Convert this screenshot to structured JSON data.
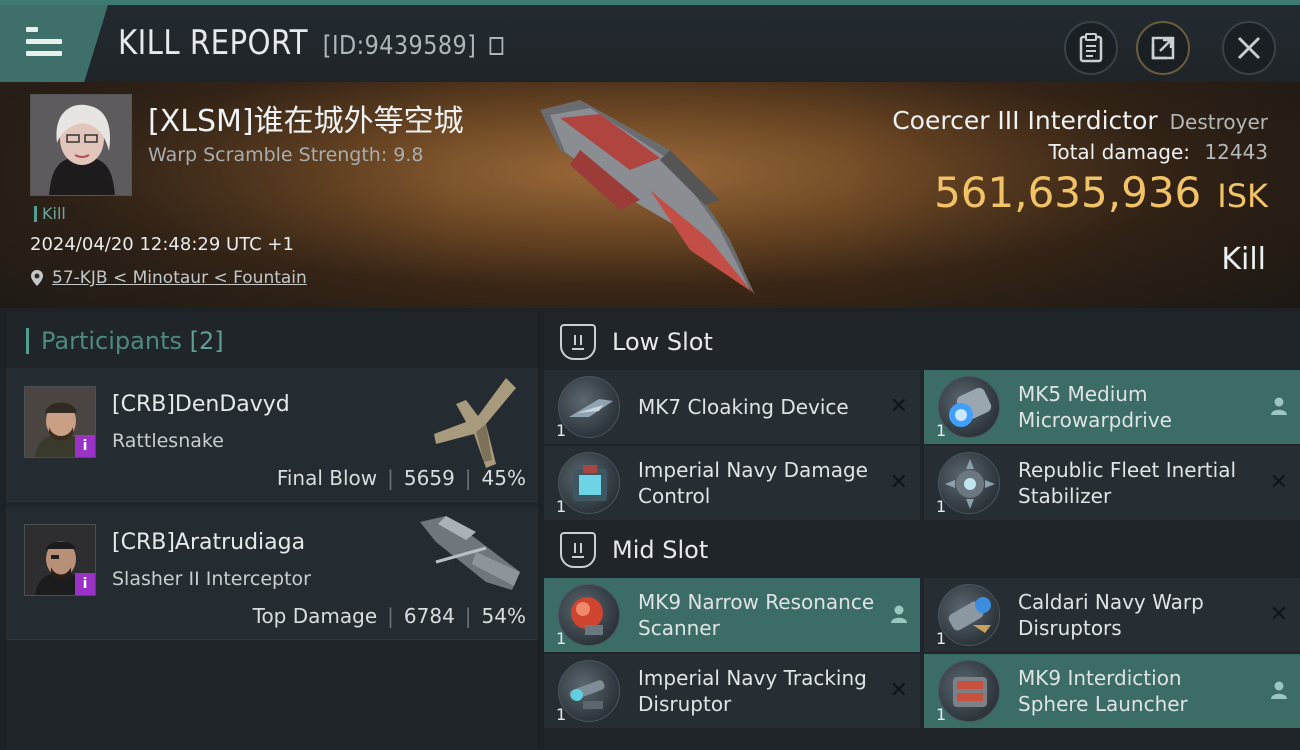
{
  "header": {
    "title": "KILL REPORT",
    "id_text": "[ID:9439589]"
  },
  "victim": {
    "pilot_name": "[XLSM]谁在城外等空城",
    "warp_scramble": "Warp Scramble Strength: 9.8",
    "tag": "Kill",
    "datetime": "2024/04/20 12:48:29 UTC +1",
    "location": "57-KJB < Minotaur < Fountain",
    "ship_name": "Coercer III Interdictor",
    "ship_class": "Destroyer",
    "total_damage_label": "Total damage:",
    "total_damage": "12443",
    "isk_value": "561,635,936",
    "isk_unit": "ISK",
    "result": "Kill"
  },
  "participants": {
    "label": "Participants",
    "count": "[2]",
    "items": [
      {
        "name": "[CRB]DenDavyd",
        "ship": "Rattlesnake",
        "role": "Final Blow",
        "damage": "5659",
        "percent": "45%",
        "badge": "i"
      },
      {
        "name": "[CRB]Aratrudiaga",
        "ship": "Slasher II Interceptor",
        "role": "Top Damage",
        "damage": "6784",
        "percent": "54%",
        "badge": "i"
      }
    ]
  },
  "slots": {
    "low": {
      "label": "Low Slot",
      "items": [
        {
          "name": "MK7 Cloaking Device",
          "qty": "1",
          "status": "destroyed"
        },
        {
          "name": "MK5 Medium Microwarpdrive",
          "qty": "1",
          "status": "dropped"
        },
        {
          "name": "Imperial Navy Damage Control",
          "qty": "1",
          "status": "destroyed"
        },
        {
          "name": "Republic Fleet Inertial Stabilizer",
          "qty": "1",
          "status": "destroyed"
        }
      ]
    },
    "mid": {
      "label": "Mid Slot",
      "items": [
        {
          "name": "MK9 Narrow Resonance Scanner",
          "qty": "1",
          "status": "dropped"
        },
        {
          "name": "Caldari Navy Warp Disruptors",
          "qty": "1",
          "status": "destroyed"
        },
        {
          "name": "Imperial Navy Tracking Disruptor",
          "qty": "1",
          "status": "destroyed"
        },
        {
          "name": "MK9 Interdiction Sphere Launcher",
          "qty": "1",
          "status": "dropped"
        }
      ]
    }
  },
  "icons": {
    "menu": "menu-icon",
    "clipboard": "clipboard-icon",
    "share": "share-icon",
    "close": "close-icon",
    "location": "location-pin-icon",
    "destroyed": "x-icon",
    "dropped": "person-icon"
  },
  "colors": {
    "accent": "#3e7069",
    "isk": "#f2c266",
    "dropped_bg": "#3b6c66"
  }
}
